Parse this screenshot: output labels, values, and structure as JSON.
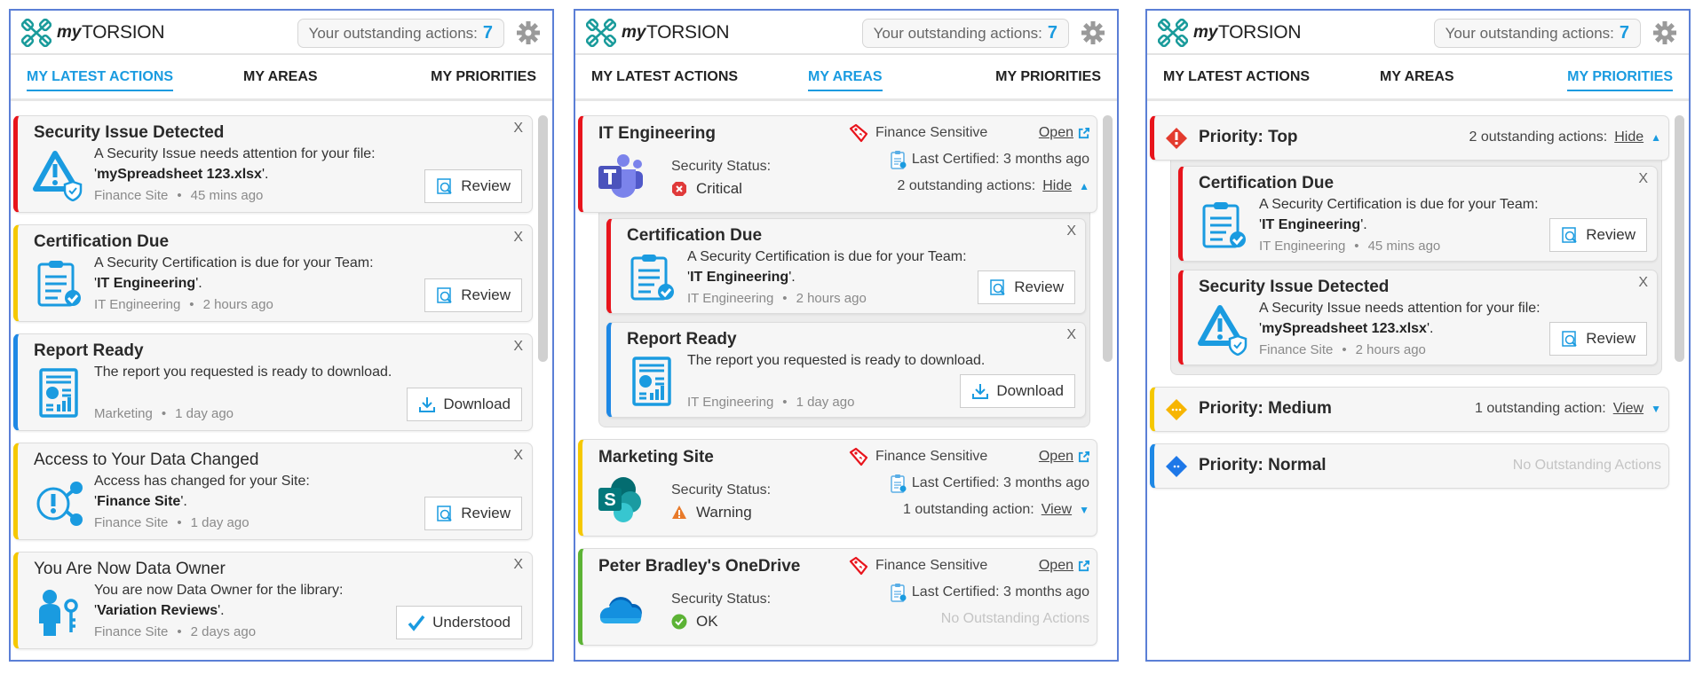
{
  "header": {
    "logo_my": "my",
    "logo_brand": "TORSION",
    "outstanding_label": "Your outstanding actions:",
    "outstanding_count": "7"
  },
  "tabs": [
    "MY LATEST ACTIONS",
    "MY AREAS",
    "MY PRIORITIES"
  ],
  "colors": {
    "accent": "#1a9be0",
    "red": "#e8141c",
    "yellow": "#f5c800",
    "blue": "#1e88e5",
    "green": "#5cb335",
    "logo": "#1a9b9b"
  },
  "panels": [
    {
      "active_tab": 0,
      "actions": [
        {
          "title": "Security Issue Detected",
          "bold": true,
          "icon": "warning-shield-icon",
          "accent": "#e8141c",
          "message": "A Security Issue needs attention for your file:",
          "highlight": "mySpreadsheet 123.xlsx",
          "source": "Finance Site",
          "time": "45 mins ago",
          "button": "Review",
          "button_icon": "review-icon"
        },
        {
          "title": "Certification Due",
          "bold": true,
          "icon": "clipboard-check-icon",
          "accent": "#f5c800",
          "message": "A Security Certification is due for your Team:",
          "highlight": "IT Engineering",
          "source": "IT Engineering",
          "time": "2 hours ago",
          "button": "Review",
          "button_icon": "review-icon"
        },
        {
          "title": "Report Ready",
          "bold": true,
          "icon": "report-icon",
          "accent": "#1e88e5",
          "message": "The report you requested is ready to download.",
          "highlight": "",
          "source": "Marketing",
          "time": "1 day ago",
          "button": "Download",
          "button_icon": "download-icon"
        },
        {
          "title": "Access to Your Data Changed",
          "bold": false,
          "icon": "access-share-icon",
          "accent": "#f5c800",
          "message": "Access has changed for your Site:",
          "highlight": "Finance Site",
          "source": "Finance Site",
          "time": "1 day ago",
          "button": "Review",
          "button_icon": "review-icon"
        },
        {
          "title": "You Are Now Data Owner",
          "bold": false,
          "icon": "user-key-icon",
          "accent": "#f5c800",
          "message": "You are now Data Owner for the library:",
          "highlight": "Variation Reviews",
          "source": "Finance Site",
          "time": "2 days ago",
          "button": "Understood",
          "button_icon": "check-icon"
        }
      ]
    },
    {
      "active_tab": 1,
      "areas": [
        {
          "name": "IT Engineering",
          "app_icon": "teams-icon",
          "accent": "#e8141c",
          "sensitivity": "Finance Sensitive",
          "open": "Open",
          "status_label": "Security Status:",
          "status": "Critical",
          "status_icon": "critical-icon",
          "last_certified": "Last Certified: 3 months ago",
          "outstanding": "2 outstanding actions:",
          "toggle": "Hide",
          "expanded": true,
          "actions": [
            {
              "title": "Certification Due",
              "bold": true,
              "icon": "clipboard-check-icon",
              "accent": "#e8141c",
              "message": "A Security Certification is due for your Team:",
              "highlight": "IT Engineering",
              "source": "IT Engineering",
              "time": "2 hours ago",
              "button": "Review",
              "button_icon": "review-icon"
            },
            {
              "title": "Report Ready",
              "bold": true,
              "icon": "report-icon",
              "accent": "#1e88e5",
              "message": "The report you requested is ready to download.",
              "highlight": "",
              "source": "IT Engineering",
              "time": "1 day ago",
              "button": "Download",
              "button_icon": "download-icon"
            }
          ]
        },
        {
          "name": "Marketing Site",
          "app_icon": "sharepoint-icon",
          "accent": "#f5c800",
          "sensitivity": "Finance Sensitive",
          "open": "Open",
          "status_label": "Security Status:",
          "status": "Warning",
          "status_icon": "warning-icon",
          "last_certified": "Last Certified: 3 months ago",
          "outstanding": "1 outstanding action:",
          "toggle": "View",
          "expanded": false,
          "actions": []
        },
        {
          "name": "Peter Bradley's OneDrive",
          "app_icon": "onedrive-icon",
          "accent": "#5cb335",
          "sensitivity": "Finance Sensitive",
          "open": "Open",
          "status_label": "Security Status:",
          "status": "OK",
          "status_icon": "ok-icon",
          "last_certified": "Last Certified: 3 months ago",
          "outstanding": "No Outstanding Actions",
          "toggle": "",
          "expanded": false,
          "actions": []
        }
      ]
    },
    {
      "active_tab": 2,
      "priorities": [
        {
          "name": "Priority: Top",
          "icon": "priority-top-icon",
          "accent": "#e8141c",
          "outstanding": "2 outstanding actions:",
          "toggle": "Hide",
          "expanded": true,
          "actions": [
            {
              "title": "Certification Due",
              "bold": true,
              "icon": "clipboard-check-icon",
              "accent": "#e8141c",
              "message": "A Security Certification is due for your Team:",
              "highlight": "IT Engineering",
              "source": "IT Engineering",
              "time": "45 mins ago",
              "button": "Review",
              "button_icon": "review-icon"
            },
            {
              "title": "Security Issue Detected",
              "bold": true,
              "icon": "warning-shield-icon",
              "accent": "#e8141c",
              "message": "A Security Issue needs attention for your file:",
              "highlight": "mySpreadsheet 123.xlsx",
              "source": "Finance Site",
              "time": "2 hours ago",
              "button": "Review",
              "button_icon": "review-icon"
            }
          ]
        },
        {
          "name": "Priority: Medium",
          "icon": "priority-medium-icon",
          "accent": "#f5c800",
          "outstanding": "1 outstanding action:",
          "toggle": "View",
          "expanded": false,
          "actions": []
        },
        {
          "name": "Priority: Normal",
          "icon": "priority-normal-icon",
          "accent": "#1e88e5",
          "outstanding": "No Outstanding Actions",
          "toggle": "",
          "expanded": false,
          "actions": []
        }
      ]
    }
  ]
}
